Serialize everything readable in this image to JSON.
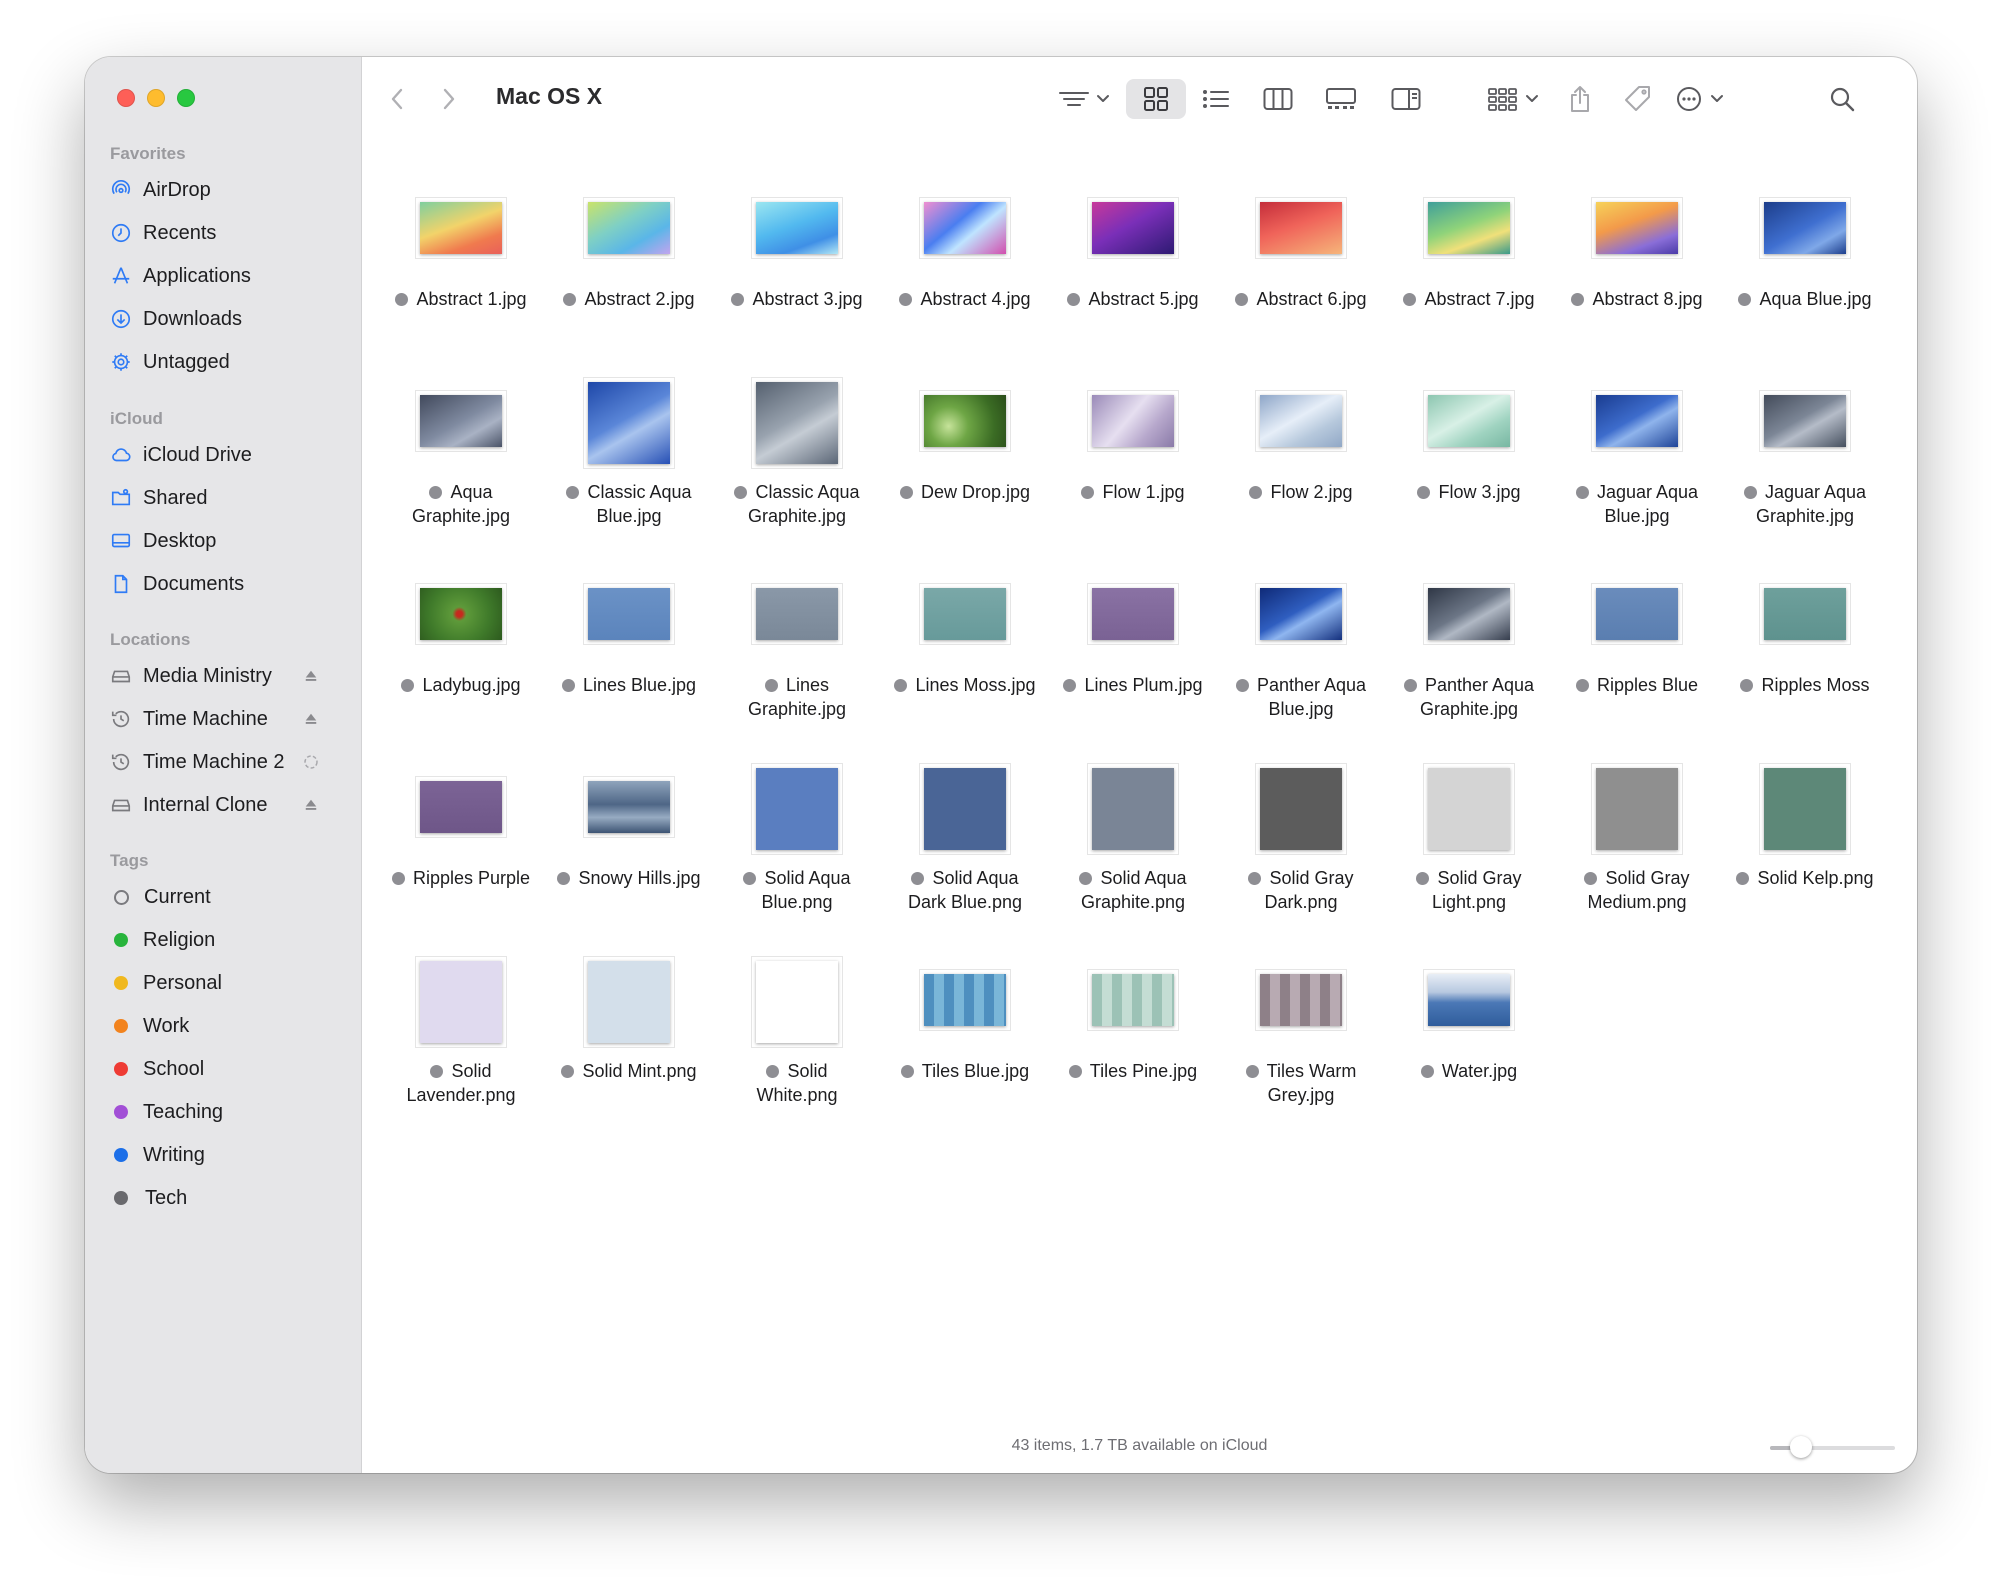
{
  "window": {
    "title": "Mac OS X"
  },
  "sidebar": {
    "favorites_heading": "Favorites",
    "favorites": [
      {
        "label": "AirDrop",
        "icon": "airdrop-icon"
      },
      {
        "label": "Recents",
        "icon": "clock-icon"
      },
      {
        "label": "Applications",
        "icon": "applications-icon"
      },
      {
        "label": "Downloads",
        "icon": "download-icon"
      },
      {
        "label": "Untagged",
        "icon": "gear-icon"
      }
    ],
    "icloud_heading": "iCloud",
    "icloud": [
      {
        "label": "iCloud Drive",
        "icon": "cloud-icon"
      },
      {
        "label": "Shared",
        "icon": "shared-folder-icon"
      },
      {
        "label": "Desktop",
        "icon": "desktop-icon"
      },
      {
        "label": "Documents",
        "icon": "document-icon"
      }
    ],
    "locations_heading": "Locations",
    "locations": [
      {
        "label": "Media Ministry",
        "icon": "drive-icon",
        "action": "eject-icon"
      },
      {
        "label": "Time Machine",
        "icon": "time-machine-icon",
        "action": "eject-icon"
      },
      {
        "label": "Time Machine 2",
        "icon": "time-machine-icon",
        "action": "sync-icon"
      },
      {
        "label": "Internal Clone",
        "icon": "drive-icon",
        "action": "eject-icon"
      }
    ],
    "tags_heading": "Tags",
    "tags": [
      {
        "label": "Current",
        "color": ""
      },
      {
        "label": "Religion",
        "color": "#28b43c"
      },
      {
        "label": "Personal",
        "color": "#f0b81e"
      },
      {
        "label": "Work",
        "color": "#f2831e"
      },
      {
        "label": "School",
        "color": "#ee3b34"
      },
      {
        "label": "Teaching",
        "color": "#a24fd6"
      },
      {
        "label": "Writing",
        "color": "#1c6fe8"
      },
      {
        "label": "Tech",
        "color": "#6a6a6e",
        "prefix": ""
      }
    ]
  },
  "toolbar": {
    "back_icon": "chevron-left-icon",
    "forward_icon": "chevron-right-icon",
    "view_mode": "icon"
  },
  "files": [
    {
      "name": "Abstract 1.jpg",
      "shape": "land",
      "fill": "linear-gradient(160deg,#7fcf9e 0%,#f2d36a 45%,#f07a4e 75%,#e9605a 100%)"
    },
    {
      "name": "Abstract 2.jpg",
      "shape": "land",
      "fill": "linear-gradient(150deg,#c9e36a 0%,#7fd0c4 40%,#5ab6e8 70%,#c2a4ee 100%)"
    },
    {
      "name": "Abstract 3.jpg",
      "shape": "land",
      "fill": "linear-gradient(160deg,#9be6f0 0%,#52b9ef 45%,#3f8fe6 75%,#b2e7f5 100%)"
    },
    {
      "name": "Abstract 4.jpg",
      "shape": "land",
      "fill": "linear-gradient(140deg,#f08fd0 0%,#4a7ef0 40%,#bfe4ff 60%,#d24fae 100%)"
    },
    {
      "name": "Abstract 5.jpg",
      "shape": "land",
      "fill": "linear-gradient(150deg,#c7399a 0%,#7a2fb8 45%,#2d1a72 100%)"
    },
    {
      "name": "Abstract 6.jpg",
      "shape": "land",
      "fill": "linear-gradient(160deg,#c42d3a 0%,#f0645a 45%,#f6b57a 100%)"
    },
    {
      "name": "Abstract 7.jpg",
      "shape": "land",
      "fill": "linear-gradient(160deg,#3f9f9a 0%,#8fd37a 45%,#f0e07a 70%,#3a9a8a 100%)"
    },
    {
      "name": "Abstract 8.jpg",
      "shape": "land",
      "fill": "linear-gradient(160deg,#f6d25a 0%,#f39a4a 40%,#8a6ed8 75%,#4b3ba8 100%)"
    },
    {
      "name": "Aqua Blue.jpg",
      "shape": "land",
      "fill": "linear-gradient(150deg,#1c3d8a 0%,#3f6fd0 50%,#7fa8e8 75%,#1d3e8c 100%)"
    },
    {
      "name": "Aqua\nGraphite.jpg",
      "shape": "land",
      "fill": "linear-gradient(150deg,#41495c 0%,#7f8aa0 50%,#a9b2c4 70%,#4b5468 100%)"
    },
    {
      "name": "Classic Aqua\nBlue.jpg",
      "shape": "square",
      "fill": "linear-gradient(150deg,#1e47a8 0%,#5a86d8 45%,#a9c4ee 60%,#2750b5 100%)"
    },
    {
      "name": "Classic Aqua\nGraphite.jpg",
      "shape": "square",
      "fill": "linear-gradient(150deg,#55606f 0%,#98a2ae 45%,#c5ccd4 60%,#5b6676 100%)"
    },
    {
      "name": "Dew Drop.jpg",
      "shape": "land",
      "fill": "radial-gradient(circle at 30% 60%,#c6e39a 0%,#6ea645 30%,#3b6c24 70%,#2a4d1a 100%)"
    },
    {
      "name": "Flow 1.jpg",
      "shape": "land",
      "fill": "linear-gradient(130deg,#9a8ab8 0%,#e6dff0 45%,#b7a8cc 70%,#8a7aa8 100%)"
    },
    {
      "name": "Flow 2.jpg",
      "shape": "land",
      "fill": "linear-gradient(150deg,#8ea6c8 0%,#e6eef8 45%,#b6c8dc 70%,#91a8c6 100%)"
    },
    {
      "name": "Flow 3.jpg",
      "shape": "land",
      "fill": "linear-gradient(150deg,#8cc6b0 0%,#d8f0e6 45%,#9fd3c0 70%,#78b7a2 100%)"
    },
    {
      "name": "Jaguar Aqua\nBlue.jpg",
      "shape": "land",
      "fill": "linear-gradient(150deg,#1a3c90 0%,#3d6ccc 45%,#8fb4ec 60%,#1f4498 100%)"
    },
    {
      "name": "Jaguar Aqua\nGraphite.jpg",
      "shape": "land",
      "fill": "linear-gradient(150deg,#434b5a 0%,#7c8696 45%,#b5bcc8 60%,#46505f 100%)"
    },
    {
      "name": "Ladybug.jpg",
      "shape": "land",
      "fill": "radial-gradient(circle at 48% 50%,#c62a1e 0%,#c62a1e 6%,#5e9a3a 14%,#3f7a2a 60%,#2d5a1e 100%)"
    },
    {
      "name": "Lines Blue.jpg",
      "shape": "land",
      "fill": "linear-gradient(180deg,#6b92c6 0%,#5b84bc 100%)"
    },
    {
      "name": "Lines\nGraphite.jpg",
      "shape": "land",
      "fill": "linear-gradient(180deg,#8a98a8 0%,#7a8898 100%)"
    },
    {
      "name": "Lines Moss.jpg",
      "shape": "land",
      "fill": "linear-gradient(180deg,#7aa8a8 0%,#679a9a 100%)"
    },
    {
      "name": "Lines Plum.jpg",
      "shape": "land",
      "fill": "linear-gradient(180deg,#8a72a4 0%,#7a6294 100%)"
    },
    {
      "name": "Panther Aqua\nBlue.jpg",
      "shape": "land",
      "fill": "linear-gradient(150deg,#0f2a78 0%,#2f5ec0 45%,#8fb6f0 60%,#14307e 100%)"
    },
    {
      "name": "Panther Aqua\nGraphite.jpg",
      "shape": "land",
      "fill": "linear-gradient(150deg,#2f3746 0%,#6c7686 45%,#b0b8c4 60%,#363e4e 100%)"
    },
    {
      "name": "Ripples Blue",
      "shape": "land",
      "fill": "linear-gradient(180deg,#6a8cbc 0%,#5a7eb0 100%)"
    },
    {
      "name": "Ripples Moss",
      "shape": "land",
      "fill": "linear-gradient(180deg,#6ea09c 0%,#5e928e 100%)"
    },
    {
      "name": "Ripples Purple",
      "shape": "land",
      "fill": "linear-gradient(180deg,#7c6496 0%,#6e5688 100%)"
    },
    {
      "name": "Snowy Hills.jpg",
      "shape": "land",
      "fill": "linear-gradient(180deg,#8fa4bc 0%,#4e6686 45%,#97abc2 70%,#3d5474 100%)"
    },
    {
      "name": "Solid Aqua\nBlue.png",
      "shape": "square",
      "fill": "#5a7ec0"
    },
    {
      "name": "Solid Aqua\nDark Blue.png",
      "shape": "square",
      "fill": "#4a6596"
    },
    {
      "name": "Solid Aqua\nGraphite.png",
      "shape": "square",
      "fill": "#7a8596"
    },
    {
      "name": "Solid Gray\nDark.png",
      "shape": "square",
      "fill": "#5c5c5c"
    },
    {
      "name": "Solid Gray\nLight.png",
      "shape": "square",
      "fill": "#d4d4d4"
    },
    {
      "name": "Solid Gray\nMedium.png",
      "shape": "square",
      "fill": "#8f8f8f"
    },
    {
      "name": "Solid Kelp.png",
      "shape": "square",
      "fill": "#5d8878"
    },
    {
      "name": "Solid\nLavender.png",
      "shape": "square",
      "fill": "#e0daef"
    },
    {
      "name": "Solid Mint.png",
      "shape": "square",
      "fill": "#d3dfea"
    },
    {
      "name": "Solid\nWhite.png",
      "shape": "square",
      "fill": "#ffffff"
    },
    {
      "name": "Tiles Blue.jpg",
      "shape": "land",
      "fill": "repeating-linear-gradient(90deg,#4e8fbf 0 10px,#7ab6d8 10px 20px),#5a9cc8"
    },
    {
      "name": "Tiles Pine.jpg",
      "shape": "land",
      "fill": "repeating-linear-gradient(90deg,#9cc2b6 0 10px,#c4ddd4 10px 20px),#a8cbbf"
    },
    {
      "name": "Tiles Warm\nGrey.jpg",
      "shape": "land",
      "fill": "repeating-linear-gradient(90deg,#8e8088 0 10px,#b8aab2 10px 20px),#9a8c94"
    },
    {
      "name": "Water.jpg",
      "shape": "land",
      "fill": "linear-gradient(180deg,#e8eef6 0%,#b7c8e0 35%,#4b78b6 55%,#2f5d9c 100%)"
    }
  ],
  "status": {
    "text": "43 items, 1.7 TB available on iCloud",
    "icon_size": 0.25
  }
}
